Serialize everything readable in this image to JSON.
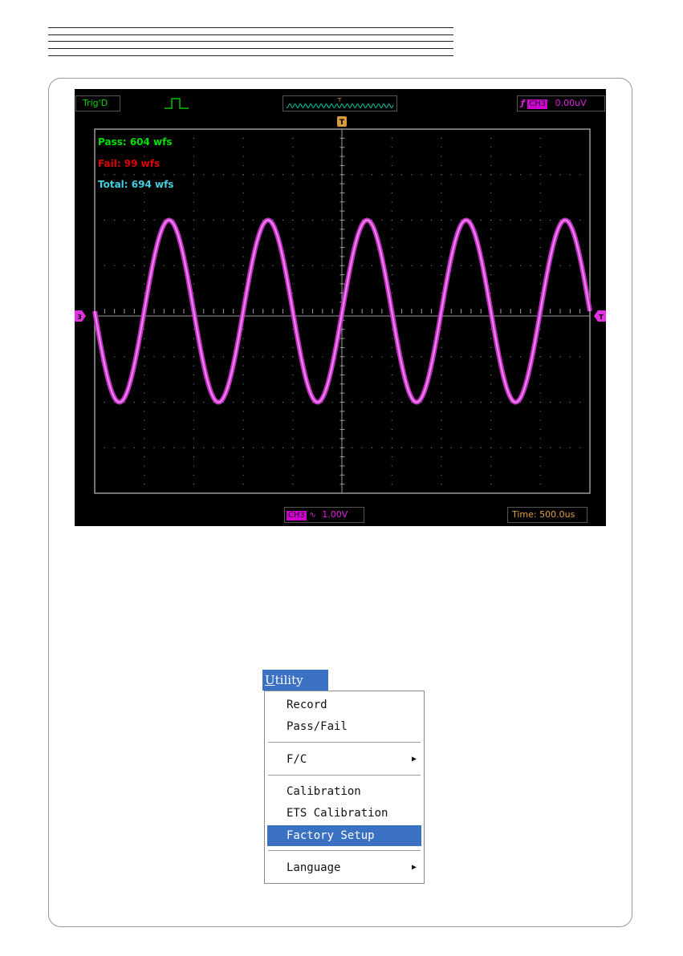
{
  "scope": {
    "trigger_status": "Trig'D",
    "trigger_marker": "T",
    "trigger_channel": "CH3",
    "trigger_level": "0.00uV",
    "channel_marker": "3",
    "channel_label": "CH3",
    "channel_scale": "1.00V",
    "coupling_symbol": "∿",
    "time_label": "Time: 500.0us",
    "pass": "Pass: 604 wfs",
    "fail": "Fail: 99 wfs",
    "total": "Total: 694 wfs",
    "colors": {
      "trace": "#e040e0",
      "pass": "#00e000",
      "fail": "#e00000",
      "total": "#40d0e0",
      "grid": "#9a9a9a",
      "trigger_marker": "#e0a040"
    },
    "wave": {
      "cycles": 5,
      "amplitude_div": 2.0,
      "phase_start": "descending-zero"
    }
  },
  "menu": {
    "title_accel": "U",
    "title_rest": "tility",
    "items": [
      {
        "label": "Record"
      },
      {
        "label": "Pass/Fail"
      },
      {
        "label": "F/C",
        "submenu": true
      },
      {
        "label": "Calibration"
      },
      {
        "label": "ETS Calibration"
      },
      {
        "label": "Factory Setup",
        "selected": true
      },
      {
        "label": "Language",
        "submenu": true
      }
    ],
    "submenu_arrow": "▶"
  }
}
